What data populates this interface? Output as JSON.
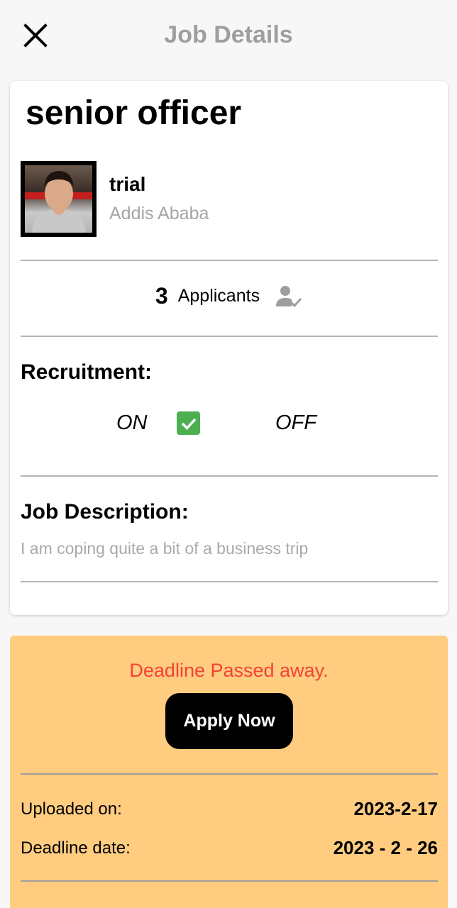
{
  "appbar": {
    "title": "Job Details",
    "close_icon": "close-icon"
  },
  "job": {
    "title": "senior officer"
  },
  "company": {
    "name": "trial",
    "location": "Addis Ababa"
  },
  "applicants": {
    "count": "3",
    "label": "Applicants",
    "icon": "person-check-icon"
  },
  "recruitment": {
    "heading": "Recruitment:",
    "on_label": "ON",
    "off_label": "OFF",
    "checked": true
  },
  "description": {
    "heading": "Job Description:",
    "text": "I am coping quite a bit of a business trip"
  },
  "status": {
    "message": "Deadline Passed away.",
    "apply_label": "Apply Now"
  },
  "dates": {
    "uploaded_label": "Uploaded on:",
    "uploaded_value": "2023-2-17",
    "deadline_label": "Deadline date:",
    "deadline_value": "2023 - 2 - 26"
  },
  "colors": {
    "background": "#f7f7f7",
    "panel": "#ffcc80",
    "error": "#f44336",
    "check": "#4caf50",
    "muted": "#9e9e9e"
  }
}
